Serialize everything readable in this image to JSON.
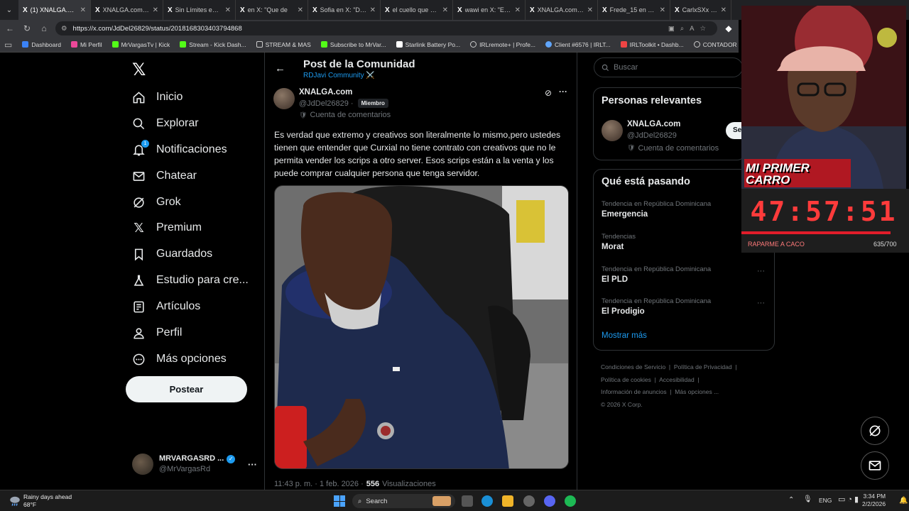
{
  "browser": {
    "tabs": [
      {
        "label": "(1) XNALGA.com e",
        "active": true
      },
      {
        "label": "XNALGA.com en",
        "active": false
      },
      {
        "label": "Sin Límites en X:",
        "active": false
      },
      {
        "label": "en X: \"Que de",
        "active": false
      },
      {
        "label": "Sofia en X: \"Domi",
        "active": false
      },
      {
        "label": "el cuello que no t",
        "active": false
      },
      {
        "label": "wawi en X: \"Estoy",
        "active": false
      },
      {
        "label": "XNALGA.com en",
        "active": false
      },
      {
        "label": "Frede_15 en X: \"D",
        "active": false
      },
      {
        "label": "CarlxSXx en X: \"Y",
        "active": false
      }
    ],
    "url": "https://x.com/JdDel26829/status/2018168303403794868",
    "bookmarks": [
      "Dashboard",
      "Mi Perfil",
      "MrVargasTv | Kick",
      "Stream - Kick Dash...",
      "STREAM & MAS",
      "Subscribe to MrVar...",
      "Starlink Battery Po...",
      "IRLremote+ | Profe...",
      "Client #6576 | IRLT...",
      "IRLToolkit • Dashb...",
      "CONTADOR"
    ]
  },
  "nav": {
    "items": [
      {
        "key": "home",
        "label": "Inicio",
        "icon": "home-icon"
      },
      {
        "key": "explore",
        "label": "Explorar",
        "icon": "search-icon"
      },
      {
        "key": "notifications",
        "label": "Notificaciones",
        "icon": "bell-icon",
        "badge": "1"
      },
      {
        "key": "chat",
        "label": "Chatear",
        "icon": "mail-icon"
      },
      {
        "key": "grok",
        "label": "Grok",
        "icon": "grok-icon"
      },
      {
        "key": "premium",
        "label": "Premium",
        "icon": "x-icon"
      },
      {
        "key": "bookmarks",
        "label": "Guardados",
        "icon": "bookmark-icon"
      },
      {
        "key": "studio",
        "label": "Estudio para cre...",
        "icon": "flask-icon"
      },
      {
        "key": "articles",
        "label": "Artículos",
        "icon": "article-icon"
      },
      {
        "key": "profile",
        "label": "Perfil",
        "icon": "person-icon"
      },
      {
        "key": "more",
        "label": "Más opciones",
        "icon": "more-circle-icon"
      }
    ],
    "post_button": "Postear",
    "account": {
      "name": "MRVARGASRD ...",
      "handle": "@MrVargasRd"
    }
  },
  "main": {
    "title": "Post de la Comunidad",
    "community": "RDJavi Community ⚔️",
    "post": {
      "author": "XNALGA.com",
      "handle": "@JdDel26829 ·",
      "role_badge": "Miembro",
      "account_type": "Cuenta de comentarios",
      "text": "Es verdad que extremo y creativos son literalmente lo mismo,pero ustedes tienen que entender que Curxial no tiene contrato con creativos que no le permita vender los scrips a otro server. Esos scrips están a la venta y los puede comprar cualquier persona que tenga servidor.",
      "timestamp": "11:43 p. m. · 1 feb. 2026 ·",
      "views": "556",
      "views_label": "Visualizaciones"
    }
  },
  "right": {
    "search_placeholder": "Buscar",
    "relevant": {
      "title": "Personas relevantes",
      "name": "XNALGA.com",
      "handle": "@JdDel26829",
      "account_type": "Cuenta de comentarios",
      "follow": "Se"
    },
    "trending": {
      "title": "Qué está pasando",
      "items": [
        {
          "meta": "Tendencia en República Dominicana",
          "name": "Emergencia"
        },
        {
          "meta": "Tendencias",
          "name": "Morat"
        },
        {
          "meta": "Tendencia en República Dominicana",
          "name": "El PLD"
        },
        {
          "meta": "Tendencia en República Dominicana",
          "name": "El Prodigio"
        }
      ],
      "show_more": "Mostrar más"
    },
    "footer": {
      "line1": [
        "Condiciones de Servicio",
        "Política de Privacidad"
      ],
      "line2": [
        "Política de cookies",
        "Accesibilidad"
      ],
      "line3": [
        "Información de anuncios",
        "Más opciones ..."
      ],
      "copyright": "© 2026 X Corp."
    }
  },
  "overlay": {
    "banner": "MI PRIMER CARRO",
    "timer": "47:57:51",
    "goal_label": "RAPARME A CACO",
    "goal_count": "635/700",
    "goal_progress": 0.907
  },
  "taskbar": {
    "weather_title": "Rainy days ahead",
    "weather_temp": "68°F",
    "search": "Search",
    "lang": "ENG",
    "time": "3:34 PM",
    "date": "2/2/2026"
  },
  "colors": {
    "accent": "#1d9bf0",
    "timer": "#ff3b3b",
    "bg": "#000000"
  }
}
